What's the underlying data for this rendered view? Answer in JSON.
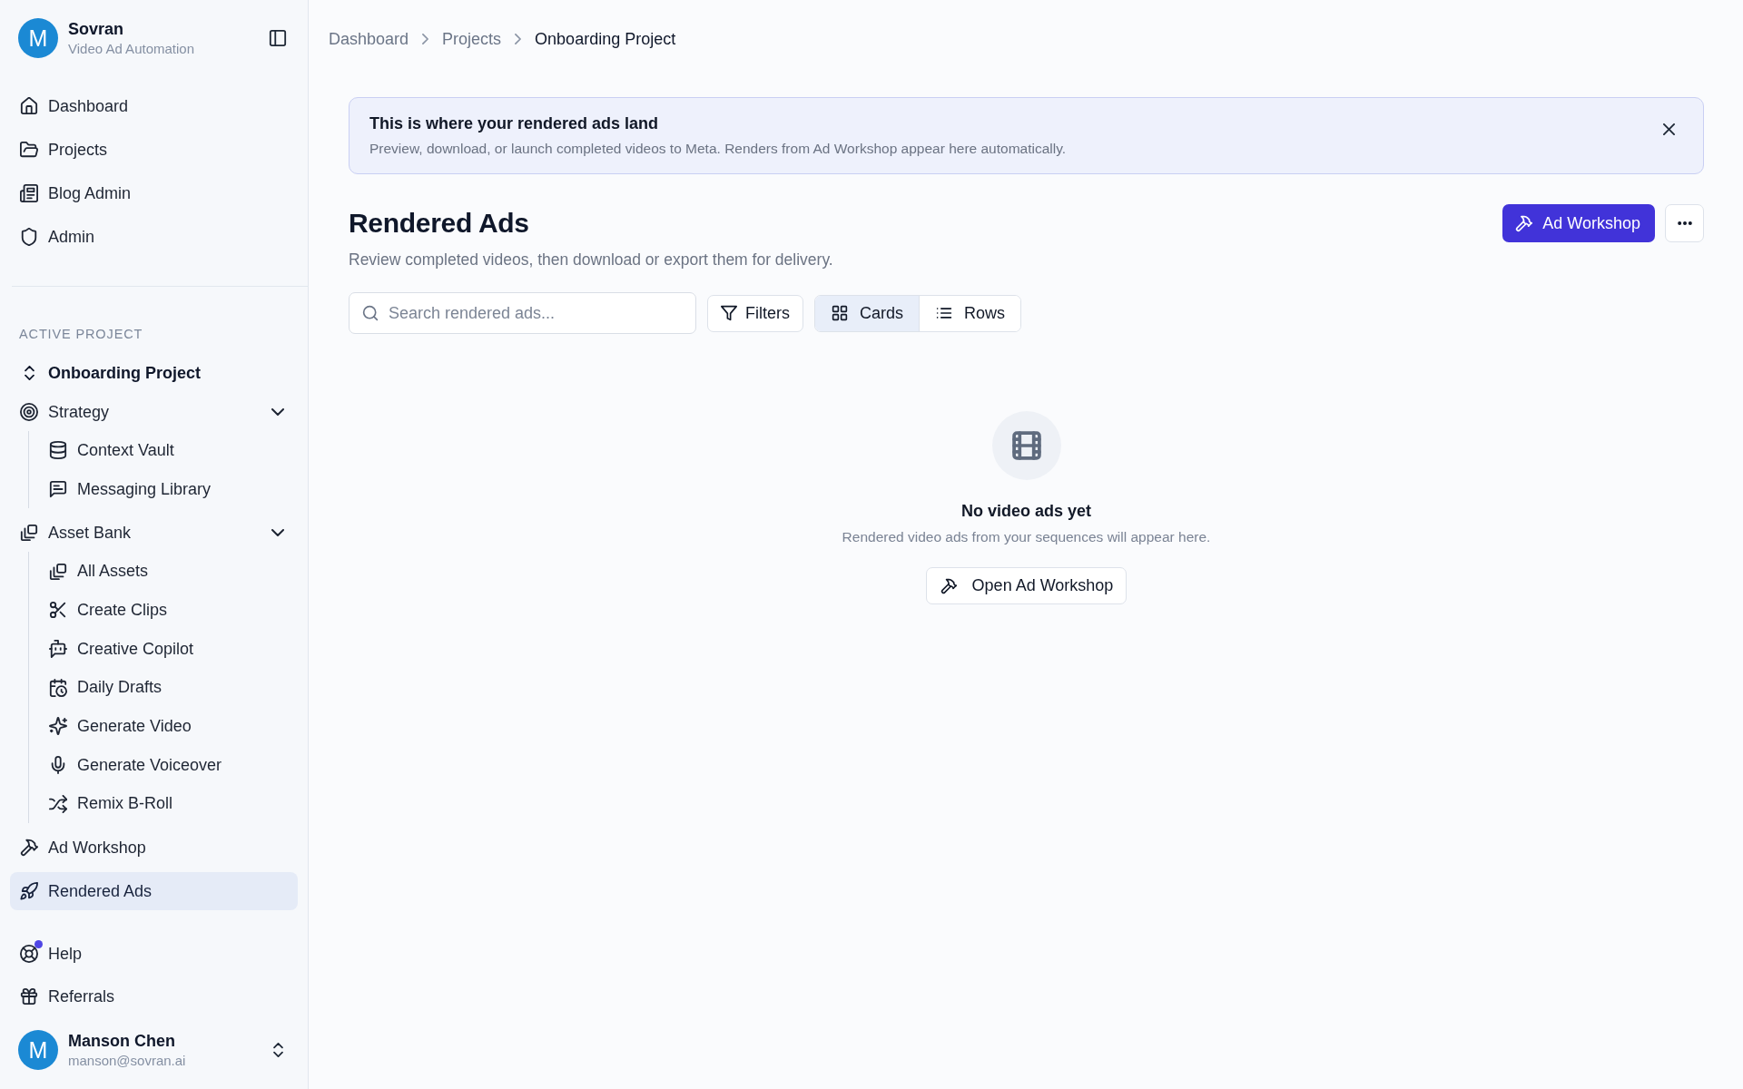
{
  "sidebar": {
    "workspace": {
      "avatar_letter": "M",
      "name": "Sovran",
      "subtitle": "Video Ad Automation"
    },
    "main_nav": [
      {
        "label": "Dashboard",
        "selected": false
      },
      {
        "label": "Projects",
        "selected": false
      },
      {
        "label": "Blog Admin",
        "selected": false
      },
      {
        "label": "Admin",
        "selected": false
      }
    ],
    "section_label": "ACTIVE PROJECT",
    "project_switcher": {
      "label": "Onboarding Project"
    },
    "project_nav": [
      {
        "label": "Strategy",
        "selected": false,
        "expanded": true,
        "children": [
          {
            "label": "Context Vault",
            "selected": false
          },
          {
            "label": "Messaging Library",
            "selected": false
          }
        ]
      },
      {
        "label": "Asset Bank",
        "selected": false,
        "expanded": true,
        "children": [
          {
            "label": "All Assets",
            "selected": false
          },
          {
            "label": "Create Clips",
            "selected": false
          },
          {
            "label": "Creative Copilot",
            "selected": false
          },
          {
            "label": "Daily Drafts",
            "selected": false
          },
          {
            "label": "Generate Video",
            "selected": false
          },
          {
            "label": "Generate Voiceover",
            "selected": false
          },
          {
            "label": "Remix B-Roll",
            "selected": false
          }
        ]
      },
      {
        "label": "Ad Workshop",
        "selected": false
      },
      {
        "label": "Rendered Ads",
        "selected": true
      }
    ],
    "footer_nav": [
      {
        "label": "Help",
        "selected": false,
        "notification": true
      },
      {
        "label": "Referrals",
        "selected": false,
        "notification": false
      }
    ],
    "user": {
      "avatar_letter": "M",
      "name": "Manson Chen",
      "email": "manson@sovran.ai"
    }
  },
  "breadcrumb": [
    {
      "label": "Dashboard",
      "current": false
    },
    {
      "label": "Projects",
      "current": false
    },
    {
      "label": "Onboarding Project",
      "current": true
    }
  ],
  "banner": {
    "title": "This is where your rendered ads land",
    "text": "Preview, download, or launch completed videos to Meta. Renders from Ad Workshop appear here automatically."
  },
  "page": {
    "title": "Rendered Ads",
    "subtitle": "Review completed videos, then download or export them for delivery.",
    "primary_button": "Ad Workshop"
  },
  "toolbar": {
    "search": {
      "placeholder": "Search rendered ads..."
    },
    "filters_button": "Filters",
    "view_modes": [
      {
        "label": "Cards",
        "selected": true
      },
      {
        "label": "Rows",
        "selected": false
      }
    ]
  },
  "empty_state": {
    "title": "No video ads yet",
    "text": "Rendered video ads from your sequences will appear here.",
    "button": "Open Ad Workshop"
  }
}
